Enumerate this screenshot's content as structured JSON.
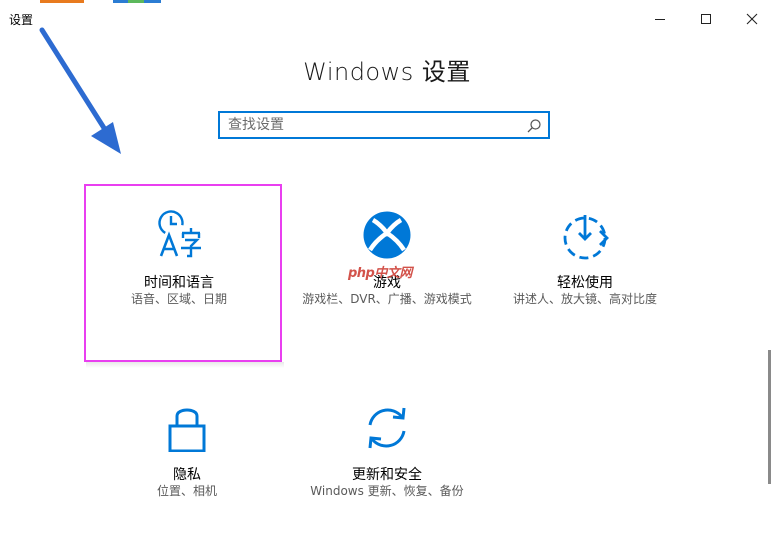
{
  "window": {
    "title": "设置"
  },
  "header": {
    "title": "Windows 设置"
  },
  "search": {
    "placeholder": "查找设置"
  },
  "tiles": [
    {
      "label": "时间和语言",
      "desc": "语音、区域、日期"
    },
    {
      "label": "游戏",
      "desc": "游戏栏、DVR、广播、游戏模式"
    },
    {
      "label": "轻松使用",
      "desc": "讲述人、放大镜、高对比度"
    },
    {
      "label": "隐私",
      "desc": "位置、相机"
    },
    {
      "label": "更新和安全",
      "desc": "Windows 更新、恢复、备份"
    }
  ],
  "watermark": {
    "text": "php中文网"
  },
  "colors": {
    "accent": "#0078d7",
    "highlight": "#e93ff0",
    "arrow": "#2d6bd1"
  }
}
